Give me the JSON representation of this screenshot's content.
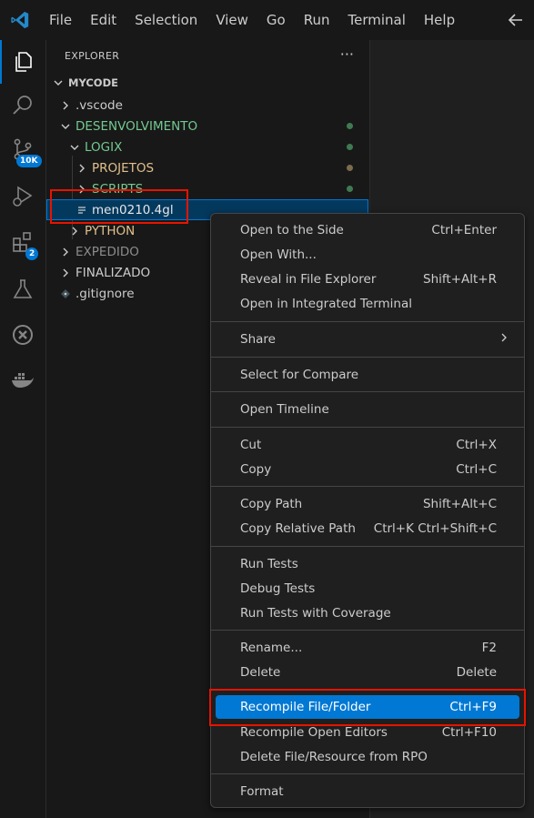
{
  "colors": {
    "accent": "#0078d4",
    "modified_folder": "#73c991",
    "untracked_folder": "#e2c08d",
    "ignored_text": "#8c8c8c",
    "highlight_box": "#e51400"
  },
  "titlebar": {
    "logo_icon": "vscode-logo-icon",
    "menu": [
      "File",
      "Edit",
      "Selection",
      "View",
      "Go",
      "Run",
      "Terminal",
      "Help"
    ],
    "back_icon": "arrow-left-icon"
  },
  "activitybar": {
    "items": [
      {
        "icon": "files-icon",
        "active": true
      },
      {
        "icon": "search-icon"
      },
      {
        "icon": "source-control-icon",
        "badge": "10K"
      },
      {
        "icon": "run-debug-icon"
      },
      {
        "icon": "extensions-icon",
        "badge": "2"
      },
      {
        "icon": "testing-flask-icon"
      },
      {
        "icon": "remote-icon"
      },
      {
        "icon": "docker-whale-icon"
      }
    ]
  },
  "sidebar": {
    "title": "EXPLORER",
    "more": "···",
    "root": "MYCODE",
    "tree": [
      {
        "label": ".vscode",
        "type": "folder-collapsed",
        "color": "default"
      },
      {
        "label": "DESENVOLVIMENTO",
        "type": "folder-expanded",
        "color": "modified",
        "dot": "modified"
      },
      {
        "label": "LOGIX",
        "type": "folder-expanded",
        "color": "modified",
        "dot": "modified"
      },
      {
        "label": "PROJETOS",
        "type": "folder-collapsed",
        "color": "untracked",
        "dot": "untracked"
      },
      {
        "label": "SCRIPTS",
        "type": "folder-collapsed",
        "color": "modified",
        "dot": "modified"
      },
      {
        "label": "men0210.4gl",
        "type": "file",
        "color": "default"
      },
      {
        "label": "PYTHON",
        "type": "folder-collapsed",
        "color": "untracked"
      },
      {
        "label": "EXPEDIDO",
        "type": "folder-collapsed",
        "color": "ignored"
      },
      {
        "label": "FINALIZADO",
        "type": "folder-collapsed",
        "color": "default"
      },
      {
        "label": ".gitignore",
        "type": "gitignore",
        "color": "default"
      }
    ]
  },
  "context_menu": {
    "groups": [
      [
        {
          "label": "Open to the Side",
          "shortcut": "Ctrl+Enter"
        },
        {
          "label": "Open With...",
          "shortcut": ""
        },
        {
          "label": "Reveal in File Explorer",
          "shortcut": "Shift+Alt+R"
        },
        {
          "label": "Open in Integrated Terminal",
          "shortcut": ""
        }
      ],
      [
        {
          "label": "Share",
          "shortcut": "",
          "submenu": true
        }
      ],
      [
        {
          "label": "Select for Compare",
          "shortcut": ""
        }
      ],
      [
        {
          "label": "Open Timeline",
          "shortcut": ""
        }
      ],
      [
        {
          "label": "Cut",
          "shortcut": "Ctrl+X"
        },
        {
          "label": "Copy",
          "shortcut": "Ctrl+C"
        }
      ],
      [
        {
          "label": "Copy Path",
          "shortcut": "Shift+Alt+C"
        },
        {
          "label": "Copy Relative Path",
          "shortcut": "Ctrl+K Ctrl+Shift+C"
        }
      ],
      [
        {
          "label": "Run Tests",
          "shortcut": ""
        },
        {
          "label": "Debug Tests",
          "shortcut": ""
        },
        {
          "label": "Run Tests with Coverage",
          "shortcut": ""
        }
      ],
      [
        {
          "label": "Rename...",
          "shortcut": "F2"
        },
        {
          "label": "Delete",
          "shortcut": "Delete"
        }
      ],
      [
        {
          "label": "Recompile File/Folder",
          "shortcut": "Ctrl+F9",
          "highlighted": true
        },
        {
          "label": "Recompile Open Editors",
          "shortcut": "Ctrl+F10"
        },
        {
          "label": "Delete File/Resource from RPO",
          "shortcut": ""
        }
      ],
      [
        {
          "label": "Format",
          "shortcut": ""
        }
      ]
    ]
  }
}
